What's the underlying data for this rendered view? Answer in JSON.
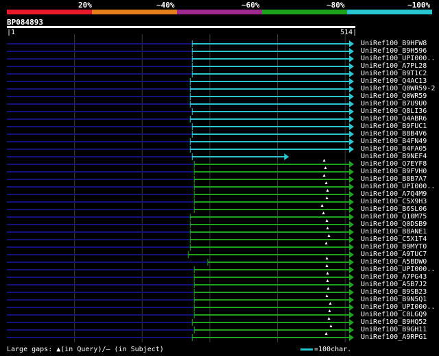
{
  "legend": {
    "segments": [
      {
        "label": "20%",
        "color": "#e8192c"
      },
      {
        "label": "~40%",
        "color": "#e67c1a"
      },
      {
        "label": "~60%",
        "color": "#a0298e"
      },
      {
        "label": "~80%",
        "color": "#1ea31e"
      },
      {
        "label": "~100%",
        "color": "#27c6d0"
      }
    ]
  },
  "query": {
    "id": "BP084893",
    "start": "1",
    "end": "514",
    "length": 514
  },
  "hits": [
    {
      "name": "UniRef100_B9HFW8",
      "from": 275,
      "to": 514,
      "color": "#27c6d0",
      "gap_query": null
    },
    {
      "name": "UniRef100_B9H596",
      "from": 275,
      "to": 514,
      "color": "#27c6d0",
      "gap_query": null
    },
    {
      "name": "UniRef100_UPI000..",
      "from": 275,
      "to": 514,
      "color": "#27c6d0",
      "gap_query": null
    },
    {
      "name": "UniRef100_A7PL28",
      "from": 275,
      "to": 514,
      "color": "#27c6d0",
      "gap_query": null
    },
    {
      "name": "UniRef100_B9T1C2",
      "from": 275,
      "to": 514,
      "color": "#27c6d0",
      "gap_query": null
    },
    {
      "name": "UniRef100_Q4AC13",
      "from": 272,
      "to": 514,
      "color": "#27c6d0",
      "gap_query": null
    },
    {
      "name": "UniRef100_Q0WR59-2",
      "from": 272,
      "to": 514,
      "color": "#27c6d0",
      "gap_query": null
    },
    {
      "name": "UniRef100_Q0WR59",
      "from": 272,
      "to": 514,
      "color": "#27c6d0",
      "gap_query": null
    },
    {
      "name": "UniRef100_B7U9U0",
      "from": 272,
      "to": 514,
      "color": "#27c6d0",
      "gap_query": null
    },
    {
      "name": "UniRef100_Q8LI36",
      "from": 275,
      "to": 514,
      "color": "#27c6d0",
      "gap_query": null
    },
    {
      "name": "UniRef100_Q4ABR6",
      "from": 272,
      "to": 514,
      "color": "#27c6d0",
      "gap_query": null
    },
    {
      "name": "UniRef100_B9FUC1",
      "from": 275,
      "to": 514,
      "color": "#27c6d0",
      "gap_query": null
    },
    {
      "name": "UniRef100_B8B4V6",
      "from": 275,
      "to": 514,
      "color": "#27c6d0",
      "gap_query": null
    },
    {
      "name": "UniRef100_B4FN49",
      "from": 272,
      "to": 514,
      "color": "#27c6d0",
      "gap_query": null
    },
    {
      "name": "UniRef100_B4FA05",
      "from": 272,
      "to": 514,
      "color": "#27c6d0",
      "gap_query": null
    },
    {
      "name": "UniRef100_B9NEF4",
      "from": 275,
      "to": 418,
      "color": "#27c6d0",
      "gap_query": null
    },
    {
      "name": "UniRef100_Q7EYF8",
      "from": 278,
      "to": 514,
      "color": "#1ea31e",
      "gap_query": 470
    },
    {
      "name": "UniRef100_B9FVH0",
      "from": 278,
      "to": 514,
      "color": "#1ea31e",
      "gap_query": 472
    },
    {
      "name": "UniRef100_B8B7A7",
      "from": 278,
      "to": 514,
      "color": "#1ea31e",
      "gap_query": 470
    },
    {
      "name": "UniRef100_UPI000..",
      "from": 278,
      "to": 514,
      "color": "#1ea31e",
      "gap_query": 473
    },
    {
      "name": "UniRef100_A7Q4M9",
      "from": 278,
      "to": 514,
      "color": "#1ea31e",
      "gap_query": 475
    },
    {
      "name": "UniRef100_C5X9H3",
      "from": 278,
      "to": 514,
      "color": "#1ea31e",
      "gap_query": 474
    },
    {
      "name": "UniRef100_B6SL06",
      "from": 278,
      "to": 514,
      "color": "#1ea31e",
      "gap_query": 467
    },
    {
      "name": "UniRef100_Q10M75",
      "from": 272,
      "to": 514,
      "color": "#1ea31e",
      "gap_query": 469
    },
    {
      "name": "UniRef100_Q0DSB9",
      "from": 272,
      "to": 514,
      "color": "#1ea31e",
      "gap_query": 474
    },
    {
      "name": "UniRef100_B8ANE1",
      "from": 272,
      "to": 514,
      "color": "#1ea31e",
      "gap_query": 475
    },
    {
      "name": "UniRef100_C5X1T4",
      "from": 272,
      "to": 514,
      "color": "#1ea31e",
      "gap_query": 477
    },
    {
      "name": "UniRef100_B9MYT0",
      "from": 272,
      "to": 514,
      "color": "#1ea31e",
      "gap_query": 473
    },
    {
      "name": "UniRef100_A9TUC7",
      "from": 269,
      "to": 514,
      "color": "#1ea31e",
      "gap_query": null
    },
    {
      "name": "UniRef100_A5BDW0",
      "from": 298,
      "to": 514,
      "color": "#1ea31e",
      "gap_query": 474
    },
    {
      "name": "UniRef100_UPI000..",
      "from": 278,
      "to": 514,
      "color": "#1ea31e",
      "gap_query": 474
    },
    {
      "name": "UniRef100_A7PG43",
      "from": 278,
      "to": 514,
      "color": "#1ea31e",
      "gap_query": 475
    },
    {
      "name": "UniRef100_A5B7J2",
      "from": 278,
      "to": 514,
      "color": "#1ea31e",
      "gap_query": 475
    },
    {
      "name": "UniRef100_B9SB23",
      "from": 278,
      "to": 514,
      "color": "#1ea31e",
      "gap_query": 476
    },
    {
      "name": "UniRef100_B9N5Q1",
      "from": 278,
      "to": 514,
      "color": "#1ea31e",
      "gap_query": 474
    },
    {
      "name": "UniRef100_UPI000..",
      "from": 278,
      "to": 514,
      "color": "#1ea31e",
      "gap_query": 479
    },
    {
      "name": "UniRef100_C0LGQ9",
      "from": 278,
      "to": 514,
      "color": "#1ea31e",
      "gap_query": 478
    },
    {
      "name": "UniRef100_B9HQ52",
      "from": 275,
      "to": 514,
      "color": "#1ea31e",
      "gap_query": 477
    },
    {
      "name": "UniRef100_B9GH11",
      "from": 278,
      "to": 514,
      "color": "#1ea31e",
      "gap_query": 480
    },
    {
      "name": "UniRef100_A9RPG1",
      "from": 275,
      "to": 514,
      "color": "#1ea31e",
      "gap_query": 473
    }
  ],
  "colors": {
    "unaligned": "#12127a",
    "grid": "#3a3a3a",
    "gap_subject": "#ffffff"
  },
  "footer": {
    "gaps_text": "Large gaps: ▲(in Query)/– (in Subject)",
    "scale_text": "=100char."
  }
}
